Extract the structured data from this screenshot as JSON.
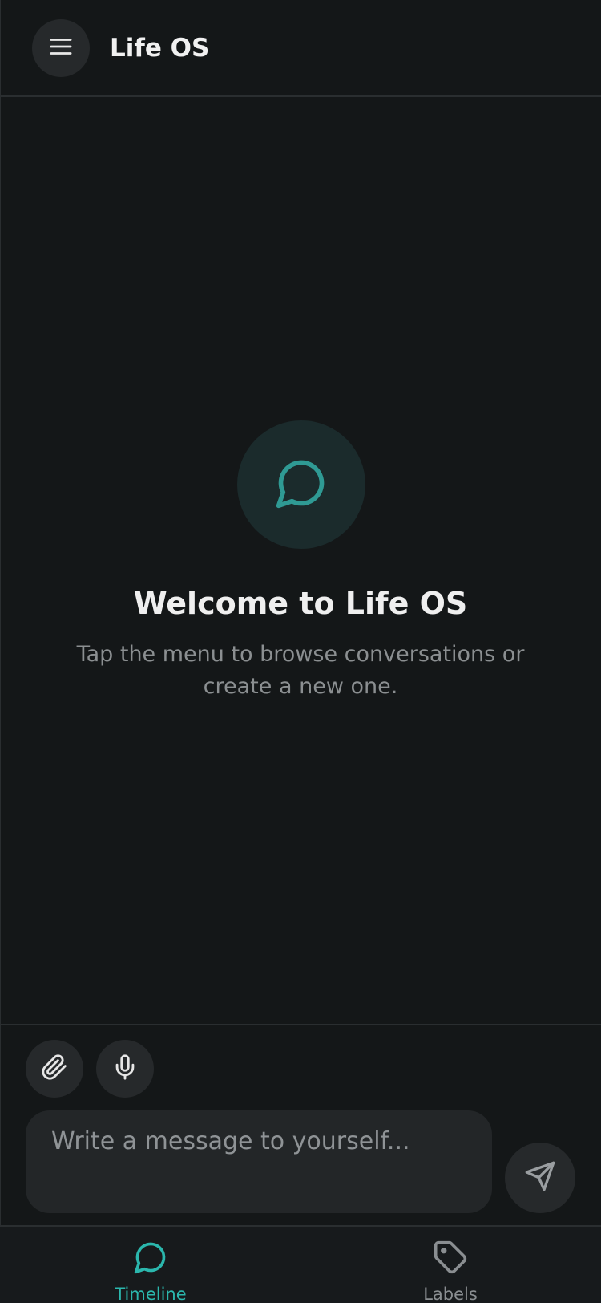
{
  "header": {
    "title": "Life OS",
    "menu_icon": "hamburger-menu-icon"
  },
  "welcome": {
    "icon": "chat-bubble-icon",
    "title": "Welcome to Life OS",
    "subtitle": "Tap the menu to browse conversations or create a new one."
  },
  "composer": {
    "attach_icon": "paperclip-icon",
    "mic_icon": "microphone-icon",
    "placeholder": "Write a message to yourself...",
    "value": "",
    "send_icon": "send-icon"
  },
  "nav": {
    "items": [
      {
        "label": "Timeline",
        "icon": "chat-bubble-icon",
        "active": true
      },
      {
        "label": "Labels",
        "icon": "tag-icon",
        "active": false
      }
    ]
  },
  "colors": {
    "background": "#141718",
    "surface": "#26292b",
    "accent": "#2bb7ad",
    "accent_dim": "#2f9a94",
    "muted_text": "#8b8f91",
    "divider": "#2a2e30"
  }
}
